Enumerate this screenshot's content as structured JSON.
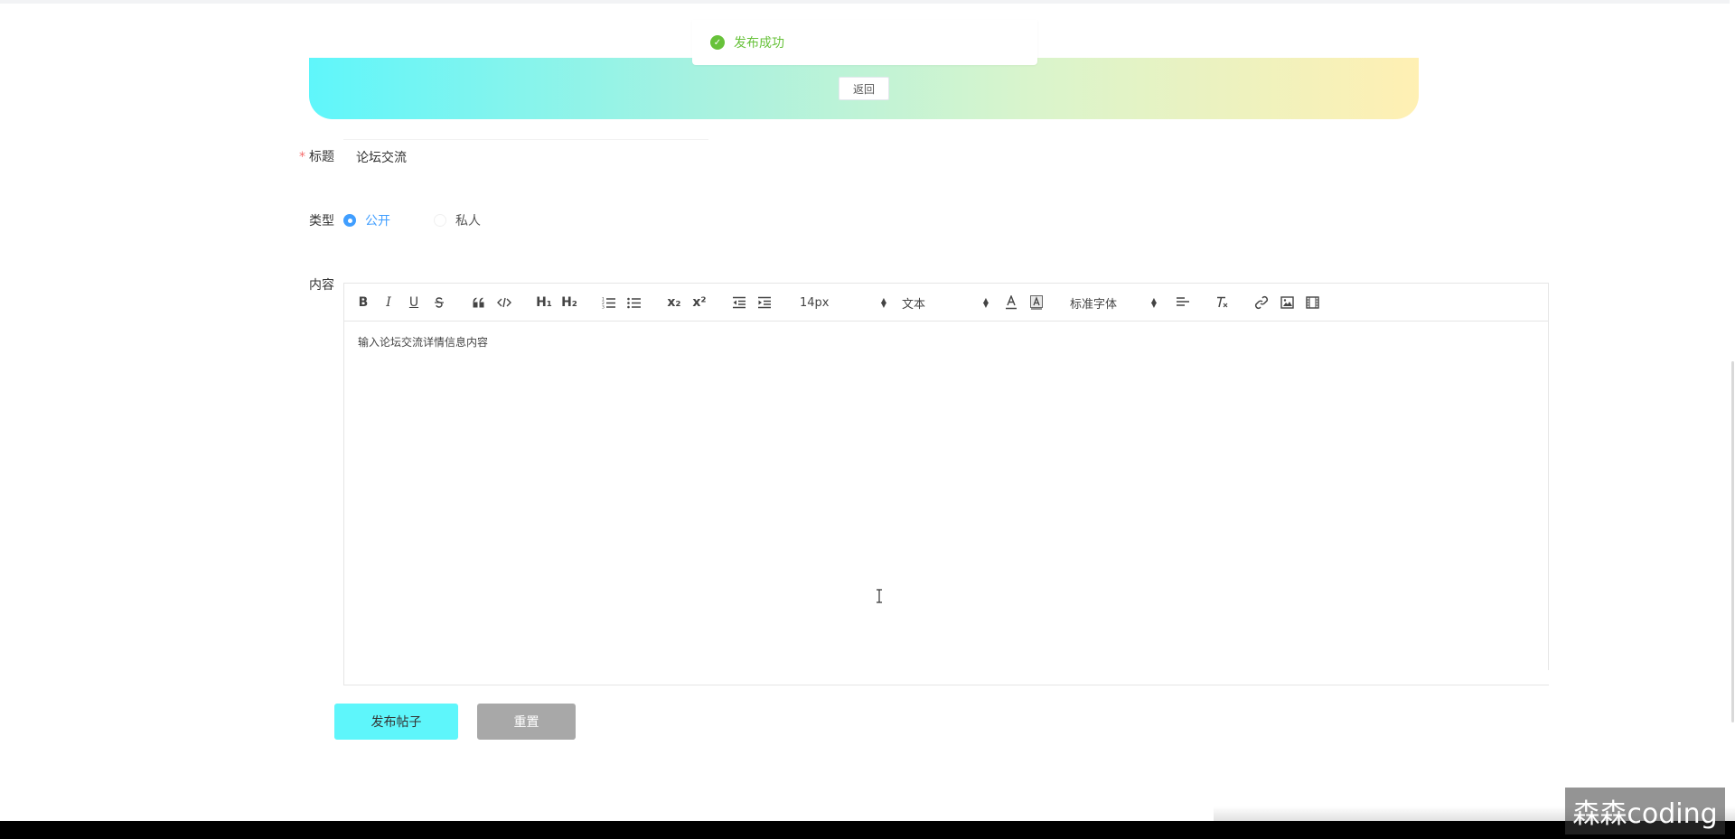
{
  "toast": {
    "message": "发布成功",
    "icon": "check-circle-icon",
    "color": "#67c23a"
  },
  "banner": {
    "back_label": "返回",
    "gradient": [
      "#5ff6fb",
      "#fff0b3"
    ]
  },
  "form": {
    "title_label": "标题",
    "required_mark": "*",
    "title_value": "论坛交流",
    "type_label": "类型",
    "type_options": [
      {
        "label": "公开",
        "checked": true
      },
      {
        "label": "私人",
        "checked": false
      }
    ],
    "content_label": "内容"
  },
  "editor": {
    "toolbar": {
      "bold": "B",
      "italic": "I",
      "underline": "U",
      "h1": "H₁",
      "h2": "H₂",
      "subscript": "x₂",
      "superscript": "x²",
      "size_value": "14px",
      "header_value": "文本",
      "font_value": "标准字体",
      "icons": [
        "bold-icon",
        "italic-icon",
        "underline-icon",
        "strike-icon",
        "blockquote-icon",
        "code-block-icon",
        "h1-icon",
        "h2-icon",
        "ordered-list-icon",
        "bullet-list-icon",
        "subscript-icon",
        "superscript-icon",
        "outdent-icon",
        "indent-icon",
        "font-color-icon",
        "background-color-icon",
        "align-icon",
        "clear-format-icon",
        "link-icon",
        "image-icon",
        "video-icon"
      ]
    },
    "placeholder": "输入论坛交流详情信息内容"
  },
  "actions": {
    "publish_label": "发布帖子",
    "reset_label": "重置",
    "publish_color": "#5ef6fb",
    "reset_color": "#a8a8a8"
  },
  "watermark": {
    "text": "森森coding"
  }
}
